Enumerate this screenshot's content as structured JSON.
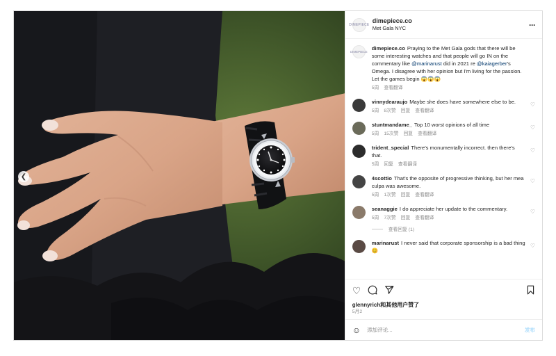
{
  "post": {
    "username": "dimepiece.co",
    "location": "Met Gala NYC",
    "logo_text": "DIMEPIECE",
    "more_icon": "more-horizontal-icon"
  },
  "caption": {
    "username": "dimepiece.co",
    "text_1": "Praying to the Met Gala gods that there will be some interesting watches and that people will go IN on the commentary like ",
    "mention_1": "@marinarust",
    "text_2": " did in 2021 re ",
    "mention_2": "@kaiagerber",
    "text_3": "'s Omega. I disagree with her opinion but I'm living for the passion. Let the games begin 😱😱😱",
    "time": "5周",
    "translate": "查看翻译"
  },
  "comments": [
    {
      "username": "vinnydearaujo",
      "text": "Maybe she does have somewhere else to be.",
      "time": "5周",
      "likes": "8次赞",
      "reply": "回复",
      "translate": "查看翻译",
      "avatar_color": "#3a3a3a"
    },
    {
      "username": "stuntmandame_",
      "text": "Top 10 worst opinions of all time",
      "time": "5周",
      "likes": "15次赞",
      "reply": "回复",
      "translate": "查看翻译",
      "avatar_color": "#6b6b5a"
    },
    {
      "username": "trident_special",
      "text": "There's monumentally incorrect. then there's that.",
      "time": "5周",
      "likes": "",
      "reply": "回复",
      "translate": "查看翻译",
      "avatar_color": "#2c2c2c"
    },
    {
      "username": "4scottio",
      "text": "That's the opposite of progressive thinking, but her mea culpa was awesome.",
      "time": "5周",
      "likes": "1次赞",
      "reply": "回复",
      "translate": "查看翻译",
      "avatar_color": "#444444"
    },
    {
      "username": "seanaggie",
      "text": "I do appreciate her update to the commentary.",
      "time": "5周",
      "likes": "7次赞",
      "reply": "回复",
      "translate": "查看翻译",
      "avatar_color": "#8a7a6a"
    },
    {
      "username": "marinarust",
      "text": "I never said that corporate sponsorship is a bad thing 😊",
      "time": "",
      "likes": "",
      "reply": "",
      "translate": "",
      "avatar_color": "#5a4a44"
    }
  ],
  "view_replies": "查看回复 (1)",
  "actions": {
    "like_icon": "heart-icon",
    "comment_icon": "comment-icon",
    "share_icon": "send-icon",
    "save_icon": "bookmark-icon"
  },
  "likes_text": "glennyrich和其他用户赞了",
  "date_text": "5月2",
  "add_comment": {
    "placeholder": "添加评论...",
    "post_label": "发布"
  },
  "carousel_prev_icon": "chevron-left-icon"
}
